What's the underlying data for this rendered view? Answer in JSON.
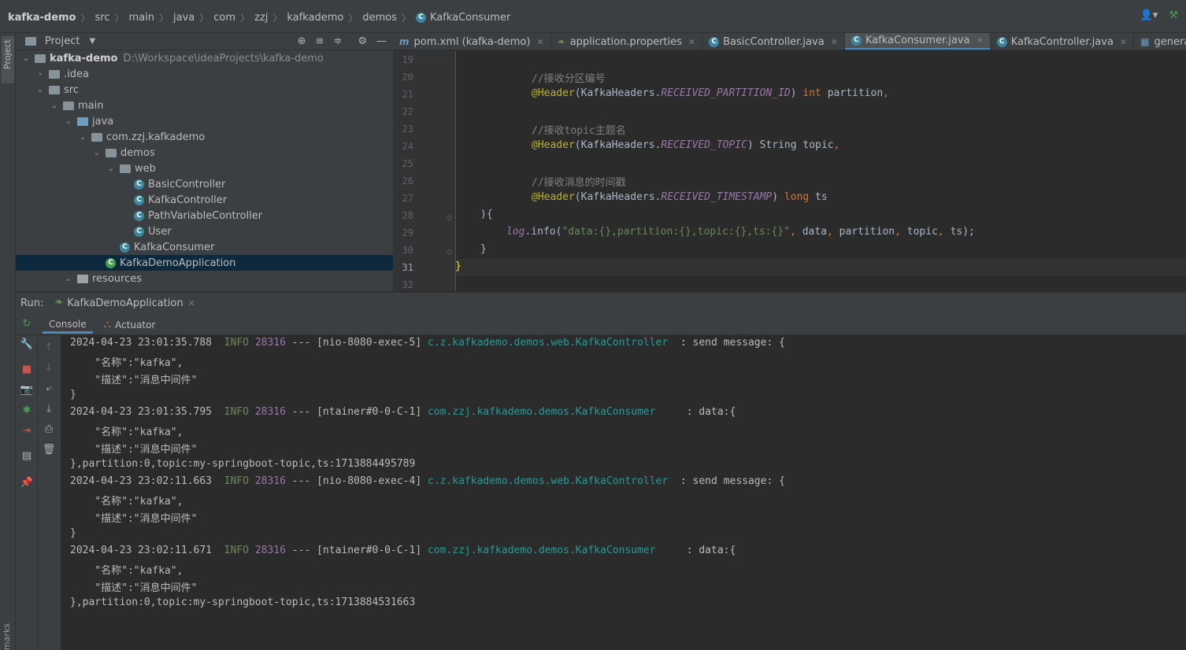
{
  "breadcrumb": [
    "kafka-demo",
    "src",
    "main",
    "java",
    "com",
    "zzj",
    "kafkademo",
    "demos",
    "KafkaConsumer"
  ],
  "project_panel": {
    "title": "Project",
    "tree": [
      {
        "label": "kafka-demo",
        "path": "D:\\Workspace\\ideaProjects\\kafka-demo",
        "arrow": "v",
        "icon": "folder"
      },
      {
        "label": ".idea",
        "arrow": ">",
        "icon": "folder"
      },
      {
        "label": "src",
        "arrow": "v",
        "icon": "folder"
      },
      {
        "label": "main",
        "arrow": "v",
        "icon": "folder"
      },
      {
        "label": "java",
        "arrow": "v",
        "icon": "source-folder"
      },
      {
        "label": "com.zzj.kafkademo",
        "arrow": "v",
        "icon": "package"
      },
      {
        "label": "demos",
        "arrow": "v",
        "icon": "package"
      },
      {
        "label": "web",
        "arrow": "v",
        "icon": "package"
      },
      {
        "label": "BasicController",
        "icon": "class"
      },
      {
        "label": "KafkaController",
        "icon": "class"
      },
      {
        "label": "PathVariableController",
        "icon": "class"
      },
      {
        "label": "User",
        "icon": "class"
      },
      {
        "label": "KafkaConsumer",
        "icon": "class"
      },
      {
        "label": "KafkaDemoApplication",
        "icon": "spring-class"
      },
      {
        "label": "resources",
        "arrow": "v",
        "icon": "resources-folder"
      }
    ]
  },
  "editor_tabs": [
    {
      "label": "pom.xml (kafka-demo)",
      "icon": "maven-icon"
    },
    {
      "label": "application.properties",
      "icon": "spring-icon"
    },
    {
      "label": "BasicController.java",
      "icon": "class-icon"
    },
    {
      "label": "KafkaConsumer.java",
      "icon": "class-icon",
      "active": true
    },
    {
      "label": "KafkaController.java",
      "icon": "class-icon"
    },
    {
      "label": "generated-requests.",
      "icon": "api-icon"
    }
  ],
  "editor": {
    "line_numbers": [
      "19",
      "20",
      "21",
      "22",
      "23",
      "24",
      "25",
      "26",
      "27",
      "28",
      "29",
      "30",
      "31",
      "32"
    ],
    "current_line": "31",
    "comments": [
      "//接收分区编号",
      "//接收topic主题名",
      "//接收消息的时间戳"
    ],
    "tokens": {
      "header": "@Header",
      "kh": "KafkaHeaders",
      "partition_id": "RECEIVED_PARTITION_ID",
      "topic_const": "RECEIVED_TOPIC",
      "timestamp": "RECEIVED_TIMESTAMP",
      "int_kw": "int",
      "string_type": "String",
      "long_kw": "long",
      "partition": "partition",
      "topic": "topic",
      "ts": "ts",
      "close_paren": "){",
      "log": "log",
      "info_call": ".info(",
      "format_str": "\"data:{},partition:{},topic:{},ts:{}\"",
      "args_data": "data",
      "end_call": ");",
      "close_brace": "}",
      "class_brace": "}"
    }
  },
  "run_window": {
    "label": "Run:",
    "config": "KafkaDemoApplication",
    "tabs": [
      "Console",
      "Actuator"
    ],
    "console": [
      {
        "ts": "2024-04-23 23:01:35.788",
        "level": "INFO",
        "pid": "28316",
        "thread": " --- [nio-8080-exec-5] ",
        "logger": "c.z.kafkademo.demos.web.KafkaController ",
        "msg": " : send message: {"
      },
      {
        "text": "    \"名称\":\"kafka\","
      },
      {
        "text": "    \"描述\":\"消息中间件\""
      },
      {
        "text": "}"
      },
      {
        "ts": "2024-04-23 23:01:35.795",
        "level": "INFO",
        "pid": "28316",
        "thread": " --- [ntainer#0-0-C-1] ",
        "logger": "com.zzj.kafkademo.demos.KafkaConsumer    ",
        "msg": " : data:{"
      },
      {
        "text": "    \"名称\":\"kafka\","
      },
      {
        "text": "    \"描述\":\"消息中间件\""
      },
      {
        "text": "},partition:0,topic:my-springboot-topic,ts:1713884495789"
      },
      {
        "ts": "2024-04-23 23:02:11.663",
        "level": "INFO",
        "pid": "28316",
        "thread": " --- [nio-8080-exec-4] ",
        "logger": "c.z.kafkademo.demos.web.KafkaController ",
        "msg": " : send message: {"
      },
      {
        "text": "    \"名称\":\"kafka\","
      },
      {
        "text": "    \"描述\":\"消息中间件\""
      },
      {
        "text": "}"
      },
      {
        "ts": "2024-04-23 23:02:11.671",
        "level": "INFO",
        "pid": "28316",
        "thread": " --- [ntainer#0-0-C-1] ",
        "logger": "com.zzj.kafkademo.demos.KafkaConsumer    ",
        "msg": " : data:{"
      },
      {
        "text": "    \"名称\":\"kafka\","
      },
      {
        "text": "    \"描述\":\"消息中间件\""
      },
      {
        "text": "},partition:0,topic:my-springboot-topic,ts:1713884531663"
      }
    ]
  },
  "side_labels": {
    "project": "Project",
    "bookmarks": "marks"
  },
  "colors": {
    "accent": "#4a88c7",
    "selection": "#0d293e",
    "logger": "#299999",
    "info": "#6a8759"
  }
}
